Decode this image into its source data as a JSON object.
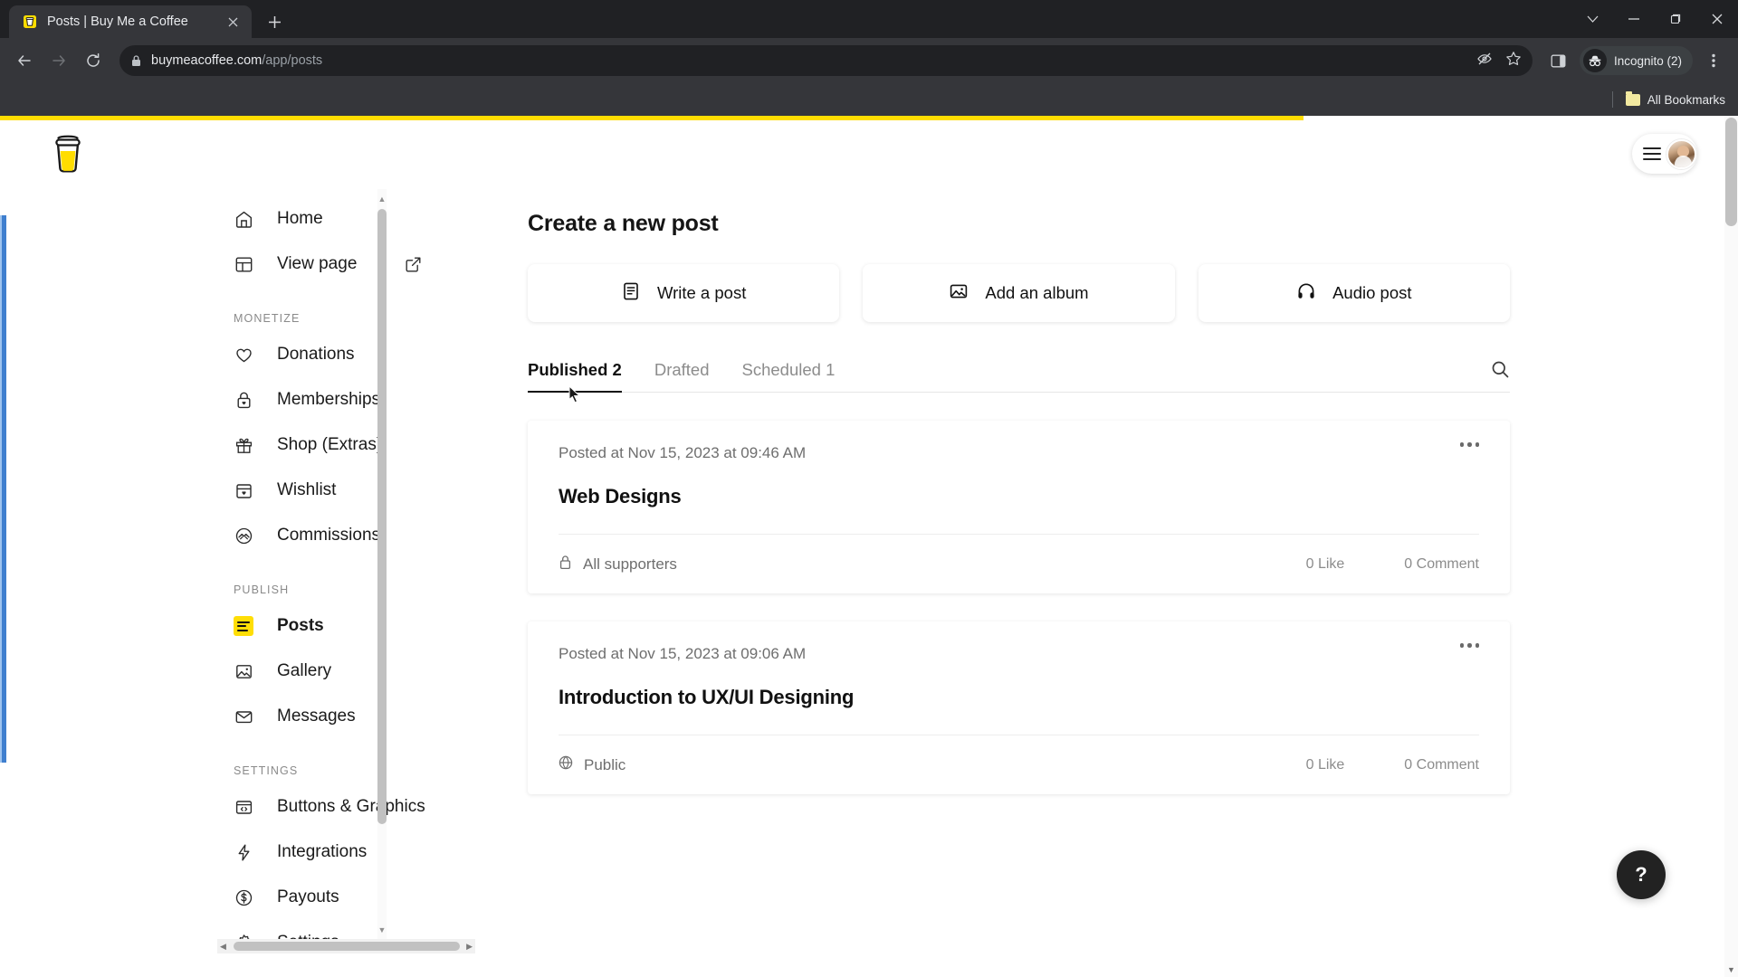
{
  "browser": {
    "tab": {
      "title": "Posts | Buy Me a Coffee",
      "favicon_icon": "coffee-cup-icon",
      "close_icon": "close-icon"
    },
    "new_tab_icon": "plus-icon",
    "window_controls": {
      "list_icon": "chevron-down-icon",
      "minimize_icon": "minimize-icon",
      "maximize_icon": "restore-icon",
      "close_icon": "close-icon"
    },
    "nav": {
      "back_icon": "back-arrow-icon",
      "forward_icon": "forward-arrow-icon",
      "reload_icon": "reload-icon"
    },
    "omnibox": {
      "lock_icon": "lock-icon",
      "domain": "buymeacoffee.com",
      "path": "/app/posts",
      "url": "buymeacoffee.com/app/posts"
    },
    "omnibox_actions": {
      "tracking_icon": "eye-off-icon",
      "bookmark_icon": "star-icon"
    },
    "side_panel_icon": "side-panel-icon",
    "profile": {
      "label": "Incognito (2)",
      "icon": "incognito-icon"
    },
    "menu_icon": "three-dot-menu-icon",
    "bookmarks": {
      "label": "All Bookmarks",
      "icon": "folder-icon"
    }
  },
  "page": {
    "loading_progress": "75",
    "logo_icon": "buymeacoffee-cup-logo",
    "header": {
      "menu_icon": "hamburger-menu-icon",
      "avatar_icon": "user-avatar"
    },
    "accent_color": "#ffdd00",
    "sidebar": {
      "items": [
        {
          "label": "Home",
          "icon": "home-icon",
          "group": null,
          "active": false
        },
        {
          "label": "View page",
          "icon": "layout-icon",
          "group": null,
          "active": false,
          "trailing_icon": "external-link-icon"
        }
      ],
      "groups": [
        {
          "title": "MONETIZE",
          "items": [
            {
              "label": "Donations",
              "icon": "heart-icon",
              "active": false
            },
            {
              "label": "Memberships",
              "icon": "lock-heart-icon",
              "active": false
            },
            {
              "label": "Shop (Extras)",
              "icon": "gift-icon",
              "active": false
            },
            {
              "label": "Wishlist",
              "icon": "wishlist-box-icon",
              "active": false
            },
            {
              "label": "Commissions",
              "icon": "handshake-icon",
              "active": false
            }
          ]
        },
        {
          "title": "PUBLISH",
          "items": [
            {
              "label": "Posts",
              "icon": "posts-icon",
              "active": true
            },
            {
              "label": "Gallery",
              "icon": "image-icon",
              "active": false
            },
            {
              "label": "Messages",
              "icon": "envelope-icon",
              "active": false
            }
          ]
        },
        {
          "title": "SETTINGS",
          "items": [
            {
              "label": "Buttons & Graphics",
              "icon": "code-window-icon",
              "active": false
            },
            {
              "label": "Integrations",
              "icon": "lightning-bolt-icon",
              "active": false
            },
            {
              "label": "Payouts",
              "icon": "dollar-circle-icon",
              "active": false
            },
            {
              "label": "Settings",
              "icon": "gear-icon",
              "active": false
            }
          ]
        }
      ]
    },
    "main": {
      "title": "Create a new post",
      "create_options": [
        {
          "label": "Write a post",
          "icon": "document-icon"
        },
        {
          "label": "Add an album",
          "icon": "image-icon"
        },
        {
          "label": "Audio post",
          "icon": "headphones-icon"
        }
      ],
      "tabs": [
        {
          "label": "Published 2",
          "active": true
        },
        {
          "label": "Drafted",
          "active": false
        },
        {
          "label": "Scheduled 1",
          "active": false
        }
      ],
      "search_icon": "search-icon",
      "posts": [
        {
          "meta": "Posted at Nov 15, 2023 at 09:46 AM",
          "title": "Web Designs",
          "visibility": "All supporters",
          "visibility_icon": "lock-icon",
          "likes": "0 Like",
          "comments": "0 Comment",
          "menu_icon": "three-dot-menu-icon"
        },
        {
          "meta": "Posted at Nov 15, 2023 at 09:06 AM",
          "title": "Introduction to UX/UI Designing",
          "visibility": "Public",
          "visibility_icon": "globe-icon",
          "likes": "0 Like",
          "comments": "0 Comment",
          "menu_icon": "three-dot-menu-icon"
        }
      ]
    },
    "help_button": {
      "label": "?",
      "icon": "question-mark-icon"
    }
  }
}
